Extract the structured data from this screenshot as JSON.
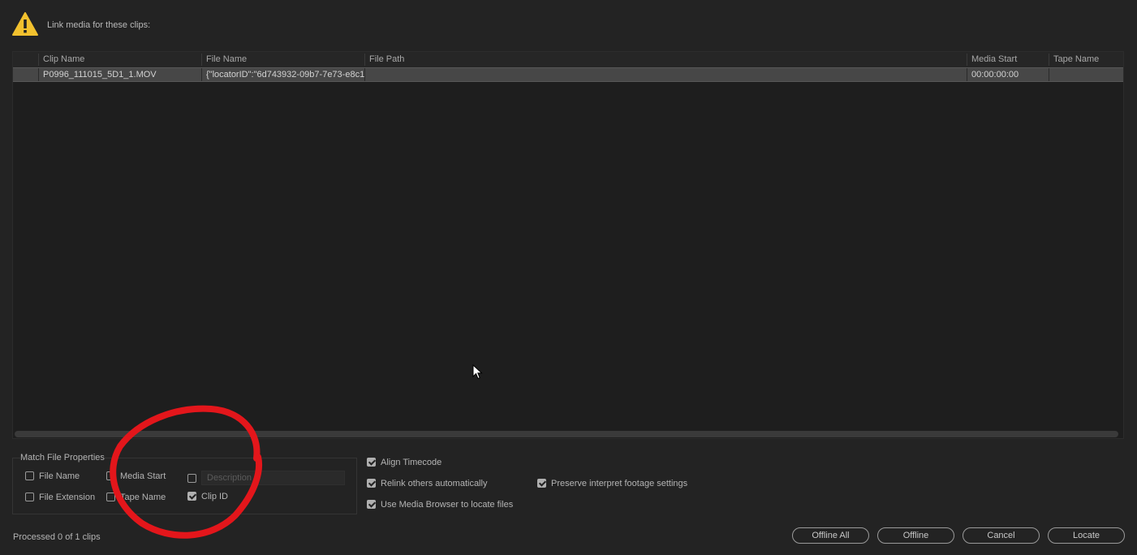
{
  "header": {
    "prompt": "Link media for these clips:",
    "icon": "warning-triangle-icon",
    "warning_color": "#f2c12e"
  },
  "table": {
    "columns": [
      "Clip Name",
      "File Name",
      "File Path",
      "Media Start",
      "Tape Name"
    ],
    "rows": [
      {
        "clip_name": "P0996_111015_5D1_1.MOV",
        "file_name": "{\"locatorID\":\"6d743932-09b7-7e73-e8c1",
        "file_path": "",
        "media_start": "00:00:00:00",
        "tape_name": ""
      }
    ]
  },
  "match_file_properties": {
    "title": "Match File Properties",
    "file_name": {
      "label": "File Name",
      "checked": false
    },
    "media_start": {
      "label": "Media Start",
      "checked": false
    },
    "description": {
      "label": "Description",
      "checked": false
    },
    "file_extension": {
      "label": "File Extension",
      "checked": false
    },
    "tape_name": {
      "label": "Tape Name",
      "checked": false
    },
    "clip_id": {
      "label": "Clip ID",
      "checked": true
    }
  },
  "options": {
    "align_timecode": {
      "label": "Align Timecode",
      "checked": true
    },
    "relink_others": {
      "label": "Relink others automatically",
      "checked": true
    },
    "use_media_browser": {
      "label": "Use Media Browser to locate files",
      "checked": true
    },
    "preserve_interpret": {
      "label": "Preserve interpret footage settings",
      "checked": true
    }
  },
  "status": "Processed 0 of 1 clips",
  "buttons": {
    "offline_all": "Offline All",
    "offline": "Offline",
    "cancel": "Cancel",
    "locate": "Locate"
  },
  "annotation_color": "#e3161b"
}
